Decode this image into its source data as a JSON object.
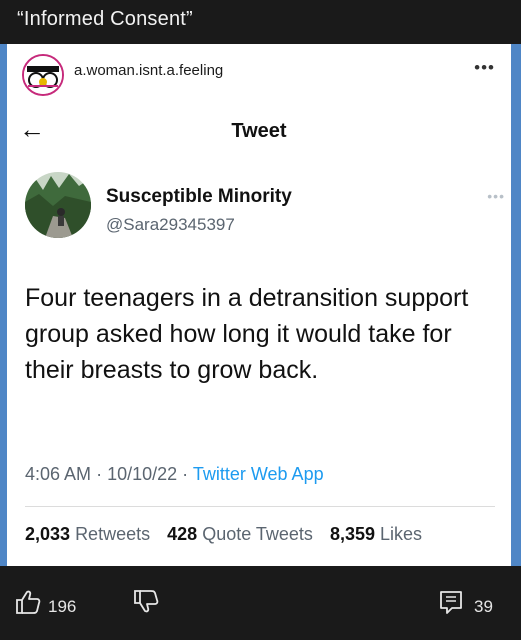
{
  "post": {
    "title": "“Informed Consent”"
  },
  "instagram": {
    "handle": "a.woman.isnt.a.feeling",
    "more": "•••"
  },
  "tweet_view": {
    "back": "←",
    "title": "Tweet",
    "more": "•••"
  },
  "tweet": {
    "display_name": "Susceptible Minority",
    "username": "@Sara29345397",
    "text": "Four teenagers in a detransition support group asked how long it would take for their breasts to grow back.",
    "time": "4:06 AM",
    "date": "10/10/22",
    "sep": "·",
    "source": "Twitter Web App"
  },
  "stats": {
    "retweets_count": "2,033",
    "retweets_label": "Retweets",
    "quotes_count": "428",
    "quotes_label": "Quote Tweets",
    "likes_count": "8,359",
    "likes_label": "Likes"
  },
  "actions": {
    "upvotes": "196",
    "comments": "39"
  },
  "colors": {
    "accent_link": "#1d9bf0",
    "background_blue": "#4f86c6",
    "ig_ring": "#c62a7b"
  }
}
